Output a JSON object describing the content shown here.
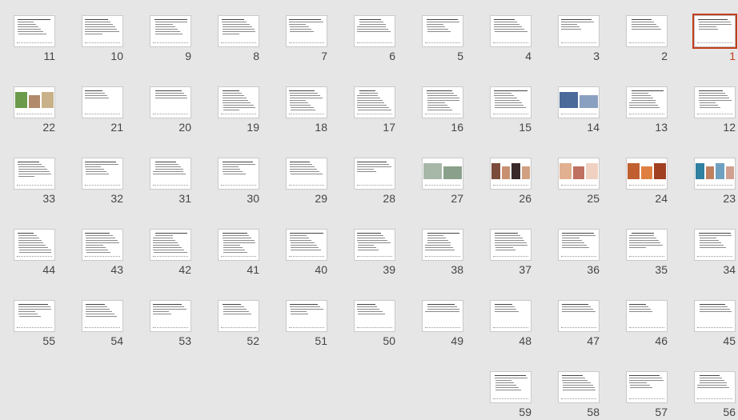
{
  "view": "slide-sorter",
  "selected_slide": "1",
  "accent_color": "#c43e1c",
  "rows": [
    [
      "11",
      "10",
      "9",
      "8",
      "7",
      "6",
      "5",
      "4",
      "3",
      "2",
      "1"
    ],
    [
      "22",
      "21",
      "20",
      "19",
      "18",
      "17",
      "16",
      "15",
      "14",
      "13",
      "12"
    ],
    [
      "33",
      "32",
      "31",
      "30",
      "29",
      "28",
      "27",
      "26",
      "25",
      "24",
      "23"
    ],
    [
      "44",
      "43",
      "42",
      "41",
      "40",
      "39",
      "38",
      "37",
      "36",
      "35",
      "34"
    ],
    [
      "55",
      "54",
      "53",
      "52",
      "51",
      "50",
      "49",
      "48",
      "47",
      "46",
      "45"
    ],
    [
      "59",
      "58",
      "57",
      "56"
    ]
  ]
}
